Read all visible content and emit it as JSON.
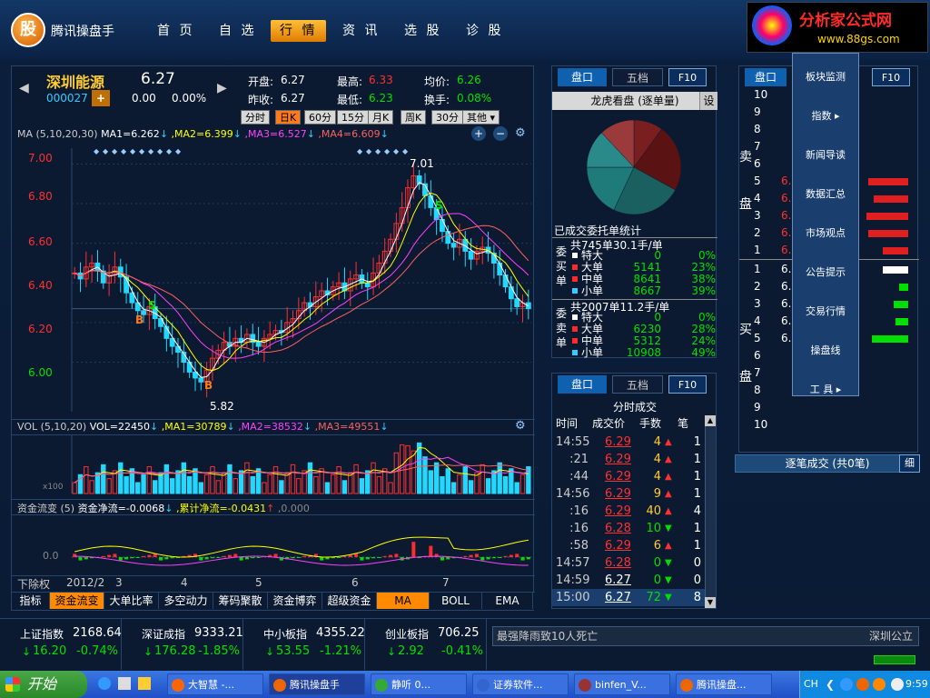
{
  "app": {
    "name": "腾讯操盘手",
    "logo_char": "股"
  },
  "nav": [
    "首 页",
    "自 选",
    "行 情",
    "资 讯",
    "选 股",
    "诊 股"
  ],
  "nav_active": 2,
  "ad": {
    "title": "分析家公式网",
    "url": "www.88gs.com"
  },
  "stock": {
    "name": "深圳能源",
    "code": "000027",
    "price": "6.27",
    "change": "0.00",
    "pct": "0.00%",
    "open_label": "开盘:",
    "open": "6.27",
    "high_label": "最高:",
    "high": "6.33",
    "avg_label": "均价:",
    "avg": "6.26",
    "prev_label": "昨收:",
    "prev": "6.27",
    "low_label": "最低:",
    "low": "6.23",
    "turnover_label": "换手:",
    "turnover": "0.08%"
  },
  "timeframes": [
    "分时",
    "日K",
    "60分",
    "15分",
    "月K",
    "周K",
    "30分",
    "其他 ▾"
  ],
  "timeframe_active": 1,
  "ma_legend": {
    "title": "MA (5,10,20,30)",
    "ma1": "MA1=6.262",
    "ma2": ",MA2=6.399",
    "ma3": ",MA3=6.527",
    "ma4": ",MA4=6.609"
  },
  "vol_legend": {
    "title": "VOL (5,10,20)",
    "vol": "VOL=22450",
    "ma1": ",MA1=30789",
    "ma2": ",MA2=38532",
    "ma3": ",MA3=49551"
  },
  "flow_legend": {
    "title": "资金流变 (5)",
    "net": "资金净流=-0.0068",
    "cum": ",累计净流=-0.0431",
    "zero": ",0.000"
  },
  "price_axis": [
    "7.00",
    "6.80",
    "6.60",
    "6.40",
    "6.20",
    "6.00"
  ],
  "annot": {
    "high": "7.01",
    "low": "5.82",
    "buy": "B",
    "sell": "S"
  },
  "date_axis": {
    "left": "下除权",
    "start": "2012/2",
    "m3": "3",
    "m4": "4",
    "m5": "5",
    "m6": "6",
    "m7": "7"
  },
  "vol_axis_label": "x100",
  "flow_axis_label": "0.0",
  "indicators": [
    "指标",
    "资金流变",
    "大单比率",
    "多空动力",
    "筹码聚散",
    "资金博弈",
    "超级资金",
    "MA",
    "BOLL",
    "EMA"
  ],
  "indicator_active": [
    1,
    7
  ],
  "pankou": {
    "tab1": "盘口",
    "tab2": "五档",
    "f10": "F10",
    "title": "龙虎看盘 (逐单量)",
    "settings": "设",
    "stats_title": "已成交委托单统计",
    "buy_label": "委买单",
    "buy_total": "共745单30.1手/单",
    "sell_label": "委卖单",
    "sell_total": "共2007单11.2手/单",
    "buy_rows": [
      [
        "特大",
        "0",
        "0%"
      ],
      [
        "大单",
        "5141",
        "23%"
      ],
      [
        "中单",
        "8641",
        "38%"
      ],
      [
        "小单",
        "8667",
        "39%"
      ]
    ],
    "sell_rows": [
      [
        "特大",
        "0",
        "0%"
      ],
      [
        "大单",
        "6230",
        "28%"
      ],
      [
        "中单",
        "5312",
        "24%"
      ],
      [
        "小单",
        "10908",
        "49%"
      ]
    ],
    "pie_colors": [
      "#7a1f1f",
      "#5a1212",
      "#1a6060",
      "#1f7a7a",
      "#2a8a8a",
      "#9a3a3a"
    ]
  },
  "ticks": {
    "tab1": "盘口",
    "tab2": "五档",
    "f10": "F10",
    "title": "分时成交",
    "headers": [
      "时间",
      "成交价",
      "手数",
      "笔"
    ],
    "rows": [
      [
        "14:55",
        "6.29",
        "4",
        "▲",
        "1"
      ],
      [
        ":21",
        "6.29",
        "4",
        "▲",
        "1"
      ],
      [
        ":44",
        "6.29",
        "4",
        "▲",
        "1"
      ],
      [
        "14:56",
        "6.29",
        "9",
        "▲",
        "1"
      ],
      [
        ":16",
        "6.29",
        "40",
        "▲",
        "4"
      ],
      [
        ":16",
        "6.28",
        "10",
        "▼",
        "1"
      ],
      [
        ":58",
        "6.29",
        "6",
        "▲",
        "1"
      ],
      [
        "14:57",
        "6.28",
        "0",
        "▼",
        "0"
      ],
      [
        "14:59",
        "6.27",
        "0",
        "▼",
        "0"
      ],
      [
        "15:00",
        "6.27",
        "72",
        "▼",
        "8"
      ]
    ]
  },
  "orderbook": {
    "tab1": "盘口",
    "f10": "F10",
    "sell_label": "卖 盘",
    "buy_label": "买 盘",
    "sell_levels": [
      "10",
      "9",
      "8",
      "7",
      "6",
      "5",
      "4",
      "3",
      "2",
      "1"
    ],
    "sell_prices": [
      "6.",
      "6.",
      "6.",
      "6.",
      "6."
    ],
    "buy_levels": [
      "1",
      "2",
      "3",
      "4",
      "5",
      "6",
      "7",
      "8",
      "9",
      "10"
    ],
    "buy_prices": [
      "6.",
      "6.",
      "6.",
      "6.",
      "6."
    ],
    "dash": "—",
    "footer": "逐笔成交 (共0笔)",
    "footer_btn": "细"
  },
  "menu": [
    "板块监测",
    "指数 ▸",
    "新闻导读",
    "数据汇总",
    "市场观点",
    "公告提示",
    "交易行情",
    "操盘线",
    "工 具 ▸"
  ],
  "indices": [
    {
      "name": "上证指数",
      "value": "2168.64",
      "chg": "16.20",
      "pct": "-0.74%"
    },
    {
      "name": "深证成指",
      "value": "9333.21",
      "chg": "176.28",
      "pct": "-1.85%"
    },
    {
      "name": "中小板指",
      "value": "4355.22",
      "chg": "53.55",
      "pct": "-1.21%"
    },
    {
      "name": "创业板指",
      "value": "706.25",
      "chg": "2.92",
      "pct": "-0.41%"
    }
  ],
  "news": "最强降雨致10人死亡",
  "news_right": "深圳公立",
  "taskbar": {
    "start": "开始",
    "items": [
      "大智慧 -...",
      "腾讯操盘手",
      "静听 0...",
      "证券软件...",
      "binfen_V...",
      "腾讯操盘..."
    ],
    "active": 1,
    "lang": "CH",
    "clock": "9:59"
  },
  "chart_data": {
    "type": "candlestick",
    "ylim": [
      5.75,
      7.08
    ],
    "closes": [
      6.45,
      6.42,
      6.48,
      6.5,
      6.46,
      6.4,
      6.44,
      6.48,
      6.43,
      6.35,
      6.3,
      6.26,
      6.24,
      6.28,
      6.22,
      6.18,
      6.12,
      6.08,
      6.05,
      6.0,
      5.95,
      5.92,
      5.9,
      5.96,
      6.02,
      6.06,
      6.1,
      6.08,
      6.12,
      6.1,
      6.14,
      6.1,
      6.08,
      6.12,
      6.14,
      6.16,
      6.15,
      6.2,
      6.22,
      6.26,
      6.3,
      6.28,
      6.33,
      6.36,
      6.34,
      6.38,
      6.4,
      6.36,
      6.42,
      6.44,
      6.4,
      6.38,
      6.45,
      6.5,
      6.56,
      6.62,
      6.7,
      6.78,
      6.88,
      6.94,
      6.9,
      6.84,
      6.78,
      6.72,
      6.66,
      6.6,
      6.58,
      6.62,
      6.56,
      6.52,
      6.56,
      6.58,
      6.55,
      6.5,
      6.44,
      6.38,
      6.32,
      6.28,
      6.3,
      6.27
    ],
    "ma_colors": [
      "#ffffff",
      "#ffff00",
      "#ff40ff",
      "#ff6060"
    ]
  }
}
